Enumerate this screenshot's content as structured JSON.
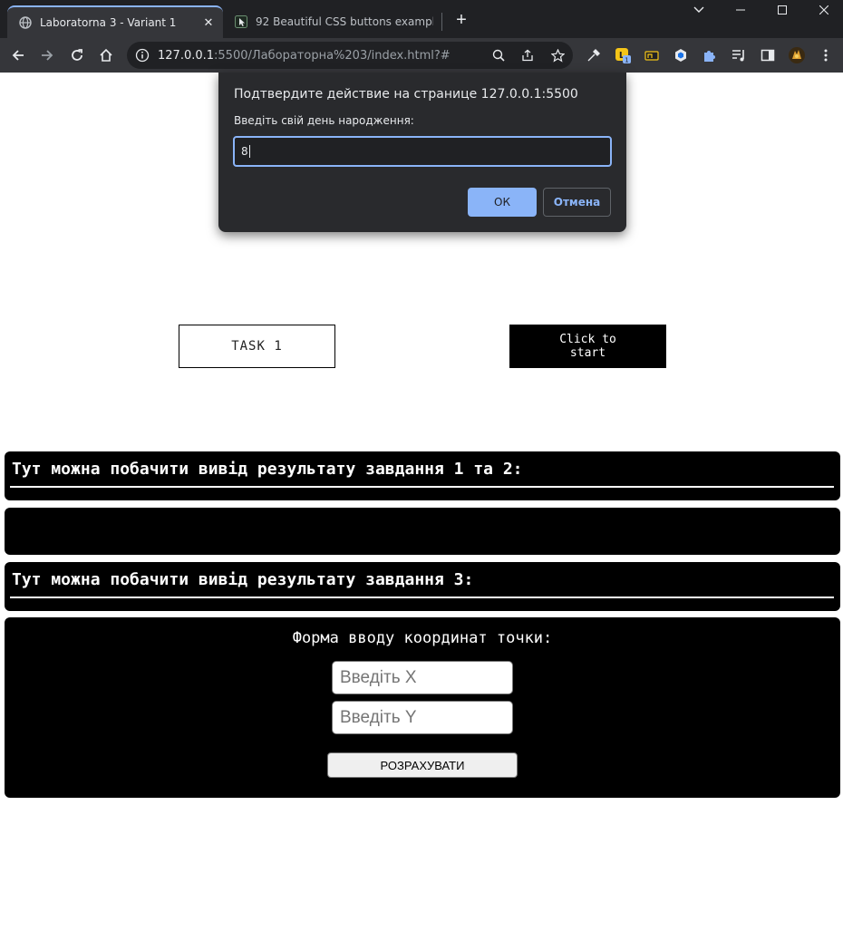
{
  "browser": {
    "tabs": [
      {
        "title": "Laboratorna 3 - Variant 1",
        "active": true,
        "icon": "globe-icon"
      },
      {
        "title": "92 Beautiful CSS buttons exampl",
        "active": false,
        "icon": "cursor-favicon-icon"
      }
    ],
    "url_host": "127.0.0.1",
    "url_rest": ":5500/Лабораторна%203/index.html?#",
    "extension_badge": "1"
  },
  "dialog": {
    "title": "Подтвердите действие на странице 127.0.0.1:5500",
    "message": "Введіть свій день народження:",
    "input_value": "8",
    "ok_label": "ОК",
    "cancel_label": "Отмена"
  },
  "page": {
    "task_button": "TASK 1",
    "start_button": "Click to start",
    "output_heading_1": "Тут можна побачити вивід результату завдання 1 та 2:",
    "output_content_1": "",
    "output_heading_3": "Тут можна побачити вивід результату завдання 3:",
    "form": {
      "title": "Форма вводу координат точки:",
      "x_placeholder": "Введіть X",
      "y_placeholder": "Введіть Y",
      "submit_label": "РОЗРАХУВАТИ"
    }
  },
  "colors": {
    "accent": "#8ab4f8",
    "chrome_dark": "#202124",
    "chrome_mid": "#35363a",
    "panel_bg": "#000000"
  }
}
